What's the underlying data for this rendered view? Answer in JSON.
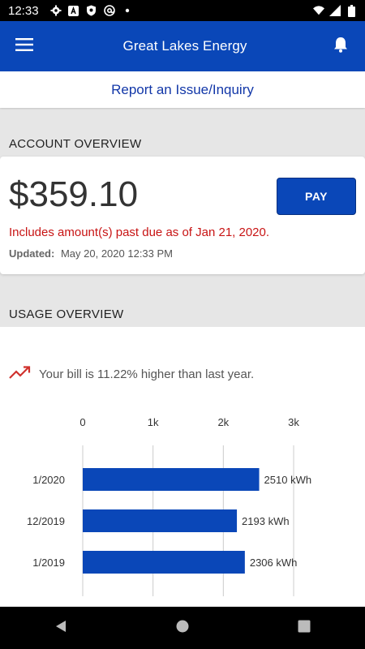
{
  "status_bar": {
    "time": "12:33",
    "icons": [
      "gear-icon",
      "a-box-icon",
      "shield-icon",
      "at-icon",
      "dot-icon"
    ],
    "right_icons": [
      "wifi-icon",
      "signal-icon",
      "battery-icon"
    ]
  },
  "app_bar": {
    "title": "Great Lakes Energy",
    "menu_icon": "hamburger-menu-icon",
    "bell_icon": "bell-icon"
  },
  "report": {
    "label": "Report an Issue/Inquiry"
  },
  "account": {
    "section_title": "ACCOUNT OVERVIEW",
    "amount": "$359.10",
    "pay_label": "PAY",
    "past_due": "Includes amount(s) past due as of Jan 21, 2020.",
    "updated_label": "Updated:",
    "updated_value": "May 20, 2020 12:33 PM"
  },
  "usage": {
    "section_title": "USAGE OVERVIEW",
    "trend_text": "Your bill is 11.22% higher than last year.",
    "trend_icon": "trending-up-icon"
  },
  "colors": {
    "primary": "#0a47b8",
    "past_due": "#c81414",
    "trend": "#d0312d",
    "bar": "#0a47b8"
  },
  "chart_data": {
    "type": "bar",
    "orientation": "horizontal",
    "categories": [
      "1/2020",
      "12/2019",
      "1/2019"
    ],
    "values": [
      2510,
      2193,
      2306
    ],
    "value_labels": [
      "2510 kWh",
      "2193 kWh",
      "2306 kWh"
    ],
    "xticks": [
      "0",
      "1k",
      "2k",
      "3k"
    ],
    "xlim": [
      0,
      3000
    ],
    "grid": true
  },
  "nav": {
    "back_icon": "back-triangle-icon",
    "home_icon": "home-circle-icon",
    "recents_icon": "recents-square-icon"
  }
}
